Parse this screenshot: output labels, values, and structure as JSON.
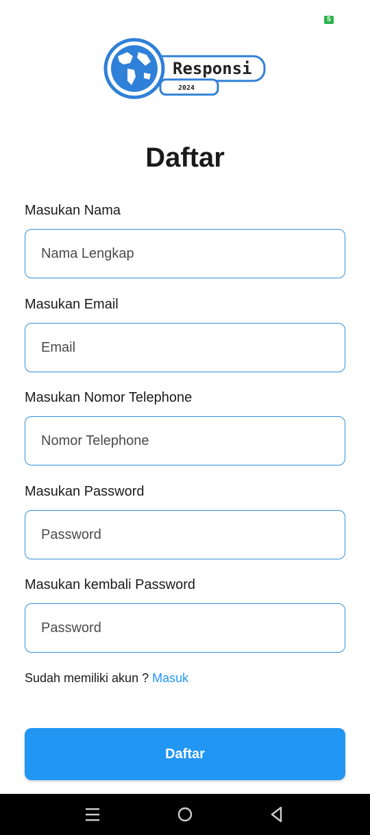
{
  "status_bar": {
    "battery": "5"
  },
  "logo": {
    "name": "Responsi",
    "year": "2024"
  },
  "page": {
    "title": "Daftar"
  },
  "form": {
    "fields": [
      {
        "label": "Masukan Nama",
        "placeholder": "Nama Lengkap"
      },
      {
        "label": "Masukan Email",
        "placeholder": "Email"
      },
      {
        "label": "Masukan Nomor Telephone",
        "placeholder": "Nomor Telephone"
      },
      {
        "label": "Masukan Password",
        "placeholder": "Password"
      },
      {
        "label": "Masukan kembali Password",
        "placeholder": "Password"
      }
    ],
    "login_prompt": "Sudah memiliki akun ?",
    "login_link": "Masuk",
    "submit_label": "Daftar"
  },
  "nav": {
    "icons": [
      "menu-icon",
      "home-icon",
      "back-icon"
    ]
  },
  "colors": {
    "accent": "#2196f3",
    "input_border": "#2f8fdb",
    "globe": "#2f80d8",
    "nav_bar": "#000000",
    "battery": "#2bb24c"
  }
}
